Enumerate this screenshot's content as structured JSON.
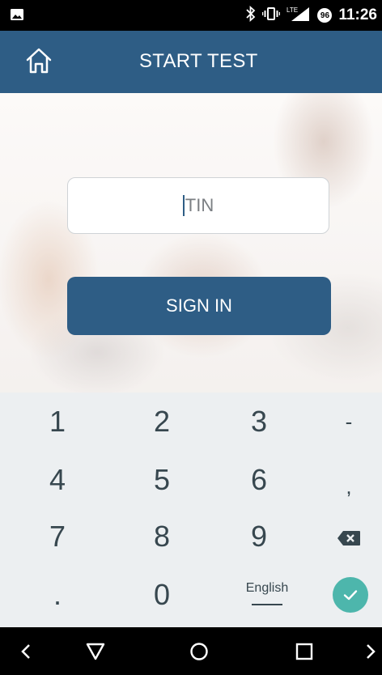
{
  "status_bar": {
    "time": "11:26",
    "battery_badge": "96",
    "icons": [
      "image-notification-icon",
      "bluetooth-icon",
      "vibrate-icon",
      "lte-signal-icon",
      "battery-icon"
    ]
  },
  "app_bar": {
    "title": "START TEST",
    "home_icon": "home-icon"
  },
  "form": {
    "tin_placeholder": "TIN",
    "sign_in_label": "SIGN IN"
  },
  "keyboard": {
    "row1": [
      "1",
      "2",
      "3",
      "-"
    ],
    "row2": [
      "4",
      "5",
      "6",
      ","
    ],
    "row3": [
      "7",
      "8",
      "9"
    ],
    "row4": [
      ".",
      "0"
    ],
    "language_label": "English",
    "backspace_icon": "backspace-icon",
    "enter_icon": "checkmark-icon",
    "accent_color": "#4db6ac"
  },
  "nav_bar": {
    "icons": [
      "chevron-left-icon",
      "back-triangle-icon",
      "home-circle-icon",
      "recents-square-icon",
      "chevron-right-icon"
    ]
  },
  "colors": {
    "primary": "#2e5d85",
    "keyboard_bg": "#eceff1",
    "key_text": "#37474f"
  }
}
